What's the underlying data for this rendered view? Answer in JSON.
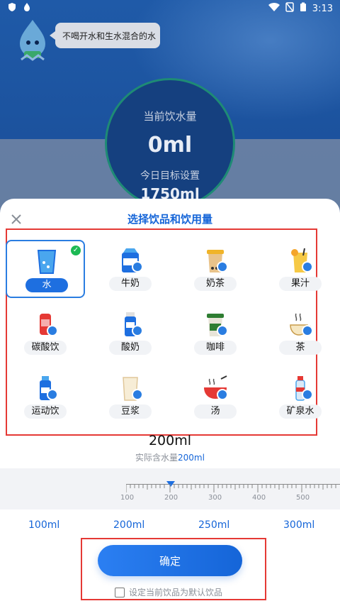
{
  "status_bar": {
    "time": "3:13"
  },
  "header": {
    "bubble_text": "不喝开水和生水混合的水"
  },
  "summary": {
    "current_label": "当前饮水量",
    "current_value": "0ml",
    "target_label": "今日目标设置",
    "target_value": "1750ml"
  },
  "sheet": {
    "title": "选择饮品和饮用量",
    "drinks": [
      {
        "label": "水",
        "icon": "water-glass",
        "selected": true,
        "locked": false
      },
      {
        "label": "牛奶",
        "icon": "milk-carton",
        "selected": false,
        "locked": true
      },
      {
        "label": "奶茶",
        "icon": "milk-tea-cup",
        "selected": false,
        "locked": true
      },
      {
        "label": "果汁",
        "icon": "juice-glass",
        "selected": false,
        "locked": true
      },
      {
        "label": "碳酸饮",
        "icon": "soda-can",
        "selected": false,
        "locked": true
      },
      {
        "label": "酸奶",
        "icon": "yogurt-bottle",
        "selected": false,
        "locked": true
      },
      {
        "label": "咖啡",
        "icon": "coffee-cup",
        "selected": false,
        "locked": true
      },
      {
        "label": "茶",
        "icon": "tea-cup",
        "selected": false,
        "locked": true
      },
      {
        "label": "运动饮",
        "icon": "sports-bottle",
        "selected": false,
        "locked": true
      },
      {
        "label": "豆浆",
        "icon": "soy-milk-glass",
        "selected": false,
        "locked": true
      },
      {
        "label": "汤",
        "icon": "soup-bowl",
        "selected": false,
        "locked": true
      },
      {
        "label": "矿泉水",
        "icon": "mineral-water-bottle",
        "selected": false,
        "locked": true
      }
    ],
    "amount": "200ml",
    "actual_water_prefix": "实际含水量",
    "actual_water_value": "200ml",
    "ruler_ticks": [
      "100",
      "200",
      "300",
      "400",
      "500"
    ],
    "quick_amounts": [
      "100ml",
      "200ml",
      "250ml",
      "300ml"
    ],
    "confirm_label": "确定",
    "default_checkbox_label": "设定当前饮品为默认饮品"
  },
  "colors": {
    "accent": "#1565d8",
    "selected_check": "#1db954",
    "highlight_frame": "#e53935"
  }
}
